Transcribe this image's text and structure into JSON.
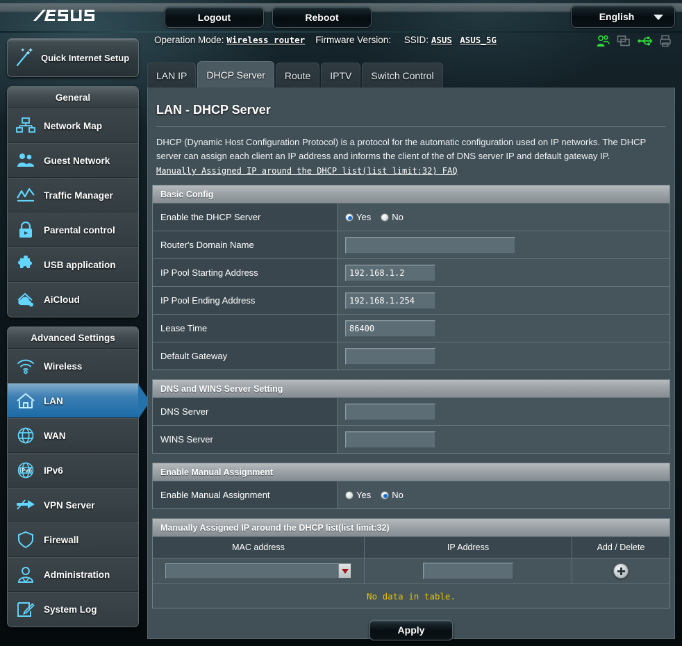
{
  "header": {
    "logo_text": "ASUS",
    "logout_label": "Logout",
    "reboot_label": "Reboot",
    "language_label": "English",
    "quick_setup_label": "Quick Internet Setup"
  },
  "infobar": {
    "operation_mode_label": "Operation Mode:",
    "operation_mode_value": "Wireless router",
    "firmware_label": "Firmware Version:",
    "firmware_value": "",
    "ssid_label": "SSID:",
    "ssid_value_1": "ASUS",
    "ssid_value_2": "ASUS_5G",
    "icons": [
      "users-icon",
      "devices-icon",
      "usb-icon",
      "printer-icon"
    ]
  },
  "sidebar": {
    "groups": [
      {
        "title": "General",
        "items": [
          {
            "label": "Network Map",
            "icon": "network-map-icon",
            "active": false
          },
          {
            "label": "Guest Network",
            "icon": "guest-network-icon",
            "active": false
          },
          {
            "label": "Traffic Manager",
            "icon": "traffic-manager-icon",
            "active": false
          },
          {
            "label": "Parental control",
            "icon": "parental-control-icon",
            "active": false
          },
          {
            "label": "USB application",
            "icon": "usb-application-icon",
            "active": false
          },
          {
            "label": "AiCloud",
            "icon": "aicloud-icon",
            "active": false
          }
        ]
      },
      {
        "title": "Advanced Settings",
        "items": [
          {
            "label": "Wireless",
            "icon": "wireless-icon",
            "active": false
          },
          {
            "label": "LAN",
            "icon": "lan-home-icon",
            "active": true
          },
          {
            "label": "WAN",
            "icon": "wan-globe-icon",
            "active": false
          },
          {
            "label": "IPv6",
            "icon": "ipv6-icon",
            "active": false
          },
          {
            "label": "VPN Server",
            "icon": "vpn-server-icon",
            "active": false
          },
          {
            "label": "Firewall",
            "icon": "firewall-shield-icon",
            "active": false
          },
          {
            "label": "Administration",
            "icon": "administration-icon",
            "active": false
          },
          {
            "label": "System Log",
            "icon": "system-log-icon",
            "active": false
          }
        ]
      }
    ]
  },
  "tabs": [
    {
      "label": "LAN IP",
      "active": false
    },
    {
      "label": "DHCP Server",
      "active": true
    },
    {
      "label": "Route",
      "active": false
    },
    {
      "label": "IPTV",
      "active": false
    },
    {
      "label": "Switch Control",
      "active": false
    }
  ],
  "main": {
    "title": "LAN - DHCP Server",
    "description": "DHCP (Dynamic Host Configuration Protocol) is a protocol for the automatic configuration used on IP networks. The DHCP server can assign each client an IP address and informs the client of the of DNS server IP and default gateway IP.",
    "faq_link": "Manually Assigned IP around the DHCP list(list limit:32) FAQ",
    "basic_config": {
      "section_title": "Basic Config",
      "enable_dhcp_label": "Enable the DHCP Server",
      "enable_dhcp_yes": "Yes",
      "enable_dhcp_no": "No",
      "enable_dhcp_selected": "Yes",
      "domain_name_label": "Router's Domain Name",
      "domain_name_value": "",
      "pool_start_label": "IP Pool Starting Address",
      "pool_start_value": "192.168.1.2",
      "pool_end_label": "IP Pool Ending Address",
      "pool_end_value": "192.168.1.254",
      "lease_time_label": "Lease Time",
      "lease_time_value": "86400",
      "default_gateway_label": "Default Gateway",
      "default_gateway_value": ""
    },
    "dns_wins": {
      "section_title": "DNS and WINS Server Setting",
      "dns_label": "DNS Server",
      "dns_value": "",
      "wins_label": "WINS Server",
      "wins_value": ""
    },
    "manual_assignment": {
      "section_title": "Enable Manual Assignment",
      "enable_label": "Enable Manual Assignment",
      "yes_label": "Yes",
      "no_label": "No",
      "selected": "No"
    },
    "assigned_table": {
      "section_title": "Manually Assigned IP around the DHCP list(list limit:32)",
      "columns": [
        "MAC address",
        "IP Address",
        "Add / Delete"
      ],
      "mac_value": "",
      "ip_value": "",
      "add_icon": "plus-circle-icon",
      "empty_text": "No data in table.",
      "rows": []
    },
    "apply_label": "Apply"
  },
  "colors": {
    "panel_bg": "#414f56",
    "accent_blue": "#1b6aa6",
    "section_header": "#9fa5a9",
    "warning_text": "#e8c400",
    "icon_glow": "#63d6ff",
    "status_green": "#2ddc3a"
  }
}
